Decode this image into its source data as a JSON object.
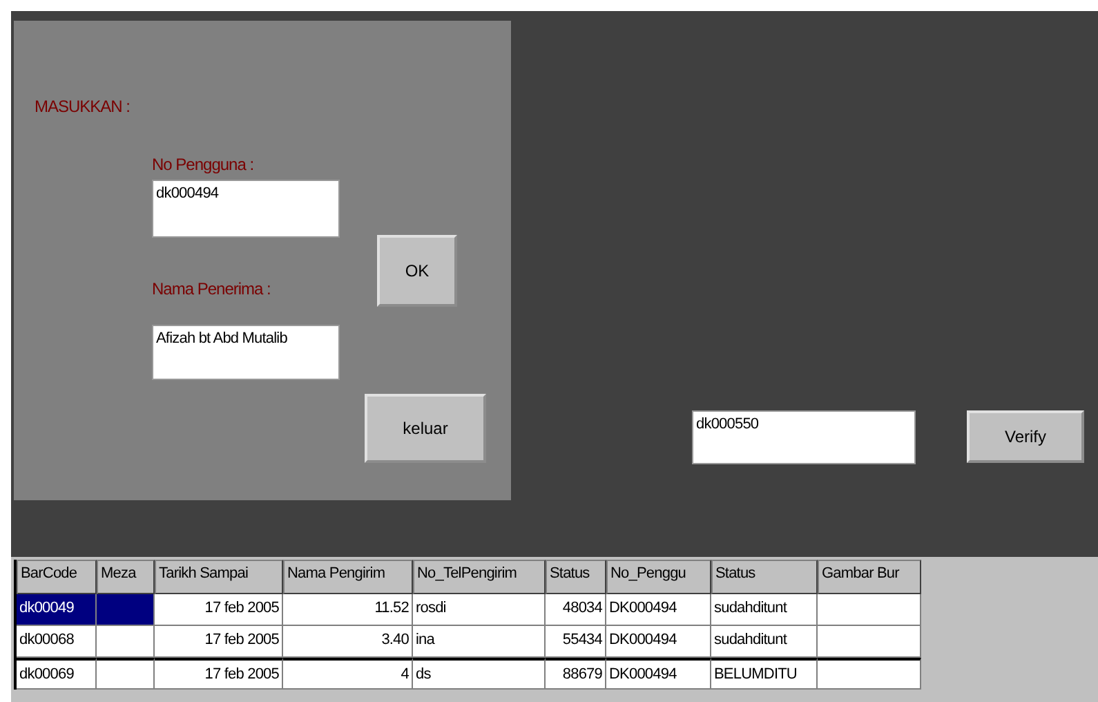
{
  "entry_panel": {
    "heading": "MASUKKAN :",
    "fields": [
      {
        "label": "No Pengguna :",
        "value": "dk000494"
      },
      {
        "label": "Nama Penerima :",
        "value": "Afizah bt Abd Mutalib"
      }
    ],
    "buttons": [
      "OK",
      "keluar"
    ]
  },
  "verify": {
    "value": "dk000550",
    "button": "Verify"
  },
  "table": {
    "columns": [
      "BarCode",
      "Meza",
      "Tarikh Sampai",
      "Nama Pengirim",
      "No_TelPengirim",
      "Status",
      "No_Penggu",
      "Status",
      "Gambar Bur"
    ],
    "rows": [
      {
        "selected": true,
        "cells": [
          "dk00049",
          "",
          "17 feb 2005",
          "11.52",
          "rosdi",
          "48034",
          "DK000494",
          "sudahditunt",
          ""
        ]
      },
      {
        "selected": false,
        "cells": [
          "dk00068",
          "",
          "17 feb 2005",
          "3.40",
          "ina",
          "55434",
          "DK000494",
          "sudahditunt",
          ""
        ]
      },
      {
        "selected": false,
        "cells": [
          "dk00069",
          "",
          "17 feb 2005",
          "4",
          "ds",
          "88679",
          "DK000494",
          "BELUMDITU",
          ""
        ]
      }
    ]
  }
}
